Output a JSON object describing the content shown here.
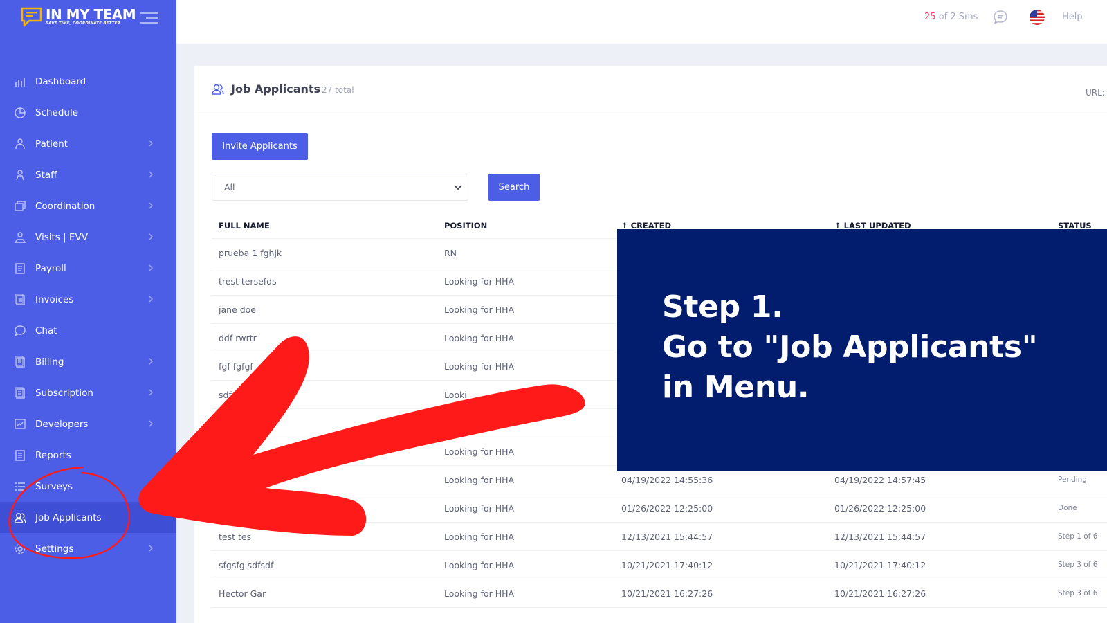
{
  "brand": {
    "name": "IN MY TEAM",
    "tagline": "SAVE TIME, COORDINATE BETTER"
  },
  "sidebar": {
    "items": [
      {
        "label": "Dashboard",
        "icon": "bar-chart-icon",
        "has_chevron": false
      },
      {
        "label": "Schedule",
        "icon": "pie-chart-icon",
        "has_chevron": false
      },
      {
        "label": "Patient",
        "icon": "person-icon",
        "has_chevron": true
      },
      {
        "label": "Staff",
        "icon": "staff-icon",
        "has_chevron": true
      },
      {
        "label": "Coordination",
        "icon": "windows-icon",
        "has_chevron": true
      },
      {
        "label": "Visits | EVV",
        "icon": "map-person-icon",
        "has_chevron": true
      },
      {
        "label": "Payroll",
        "icon": "document-icon",
        "has_chevron": true
      },
      {
        "label": "Invoices",
        "icon": "invoice-icon",
        "has_chevron": true
      },
      {
        "label": "Chat",
        "icon": "chat-icon",
        "has_chevron": false
      },
      {
        "label": "Billing",
        "icon": "billing-icon",
        "has_chevron": true
      },
      {
        "label": "Subscription",
        "icon": "subscription-icon",
        "has_chevron": true
      },
      {
        "label": "Developers",
        "icon": "code-icon",
        "has_chevron": true
      },
      {
        "label": "Reports",
        "icon": "report-icon",
        "has_chevron": false
      },
      {
        "label": "Surveys",
        "icon": "list-icon",
        "has_chevron": false
      },
      {
        "label": "Job Applicants",
        "icon": "users-icon",
        "has_chevron": false,
        "active": true
      },
      {
        "label": "Settings",
        "icon": "gear-icon",
        "has_chevron": true
      }
    ]
  },
  "topbar": {
    "sms_used": "25",
    "sms_rest": "of 2 Sms",
    "help": "Help"
  },
  "page": {
    "title": "Job Applicants",
    "total": "27 total",
    "url_label": "URL:",
    "invite_button": "Invite Applicants",
    "filter_value": "All",
    "search_button": "Search"
  },
  "table": {
    "headers": [
      "FULL NAME",
      "POSITION",
      "↑ CREATED",
      "↑ LAST UPDATED",
      "STATUS"
    ],
    "rows": [
      {
        "name": "prueba 1 fghjk",
        "position": "RN",
        "created": "",
        "updated": "",
        "status": ""
      },
      {
        "name": "trest tersefds",
        "position": "Looking for HHA",
        "created": "",
        "updated": "",
        "status": ""
      },
      {
        "name": "jane doe",
        "position": "Looking for HHA",
        "created": "",
        "updated": "",
        "status": ""
      },
      {
        "name": "ddf rwrtr",
        "position": "Looking for HHA",
        "created": "",
        "updated": "",
        "status": ""
      },
      {
        "name": "fgf fgfgf",
        "position": "Looking for HHA",
        "created": "",
        "updated": "",
        "status": ""
      },
      {
        "name": "sdf",
        "position": "Looki",
        "created": "",
        "updated": "",
        "status": ""
      },
      {
        "name": "",
        "position": "",
        "created": "",
        "updated": "",
        "status": ""
      },
      {
        "name": "",
        "position": "Looking for HHA",
        "created": "",
        "updated": "",
        "status": ""
      },
      {
        "name": "",
        "position": "Looking for HHA",
        "created": "04/19/2022 14:55:36",
        "updated": "04/19/2022 14:57:45",
        "status": "Pending"
      },
      {
        "name": "",
        "position": "Looking for HHA",
        "created": "01/26/2022 12:25:00",
        "updated": "01/26/2022 12:25:00",
        "status": "Done"
      },
      {
        "name": "test tes",
        "position": "Looking for HHA",
        "created": "12/13/2021 15:44:57",
        "updated": "12/13/2021 15:44:57",
        "status": "Step 1 of 6"
      },
      {
        "name": "sfgsfg sdfsdf",
        "position": "Looking for HHA",
        "created": "10/21/2021 17:40:12",
        "updated": "10/21/2021 17:40:12",
        "status": "Step 3 of 6"
      },
      {
        "name": "Hector Gar",
        "position": "Looking for HHA",
        "created": "10/21/2021 16:27:26",
        "updated": "10/21/2021 16:27:26",
        "status": "Step 3 of 6"
      }
    ]
  },
  "overlay": {
    "line1": "Step 1.",
    "line2": "Go to \"Job Applicants\"",
    "line3": "in Menu."
  },
  "colors": {
    "sidebar": "#4d5ee6",
    "accent": "#4d5ee6",
    "overlay": "#031d6e",
    "annotation": "#ff1a1a",
    "sms_highlight": "#f1416c"
  }
}
